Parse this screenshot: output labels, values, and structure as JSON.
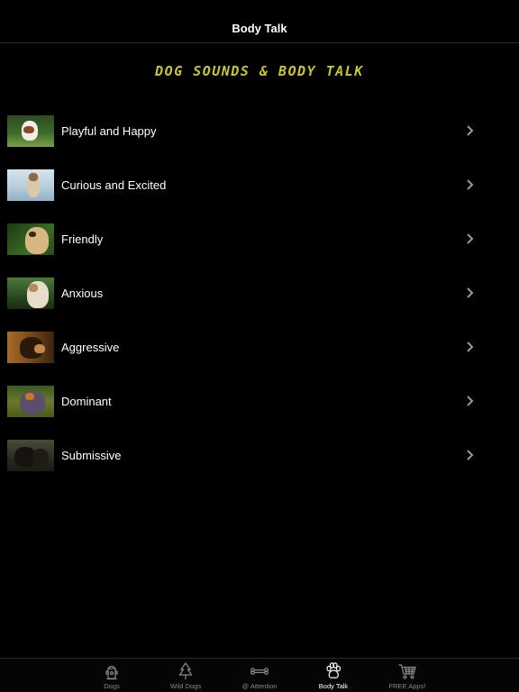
{
  "nav": {
    "title": "Body Talk"
  },
  "banner": {
    "text": "Dog Sounds & Body Talk"
  },
  "rows": [
    {
      "label": "Playful and Happy"
    },
    {
      "label": "Curious and Excited"
    },
    {
      "label": "Friendly"
    },
    {
      "label": "Anxious"
    },
    {
      "label": "Aggressive"
    },
    {
      "label": "Dominant"
    },
    {
      "label": "Submissive"
    }
  ],
  "tabs": [
    {
      "label": "Dogs",
      "icon": "fire-hydrant-icon"
    },
    {
      "label": "Wild Dogs",
      "icon": "tree-icon"
    },
    {
      "label": "@ Attention",
      "icon": "bone-icon"
    },
    {
      "label": "Body Talk",
      "icon": "paw-icon",
      "active": true
    },
    {
      "label": "FREE Apps!",
      "icon": "shopping-cart-icon"
    }
  ],
  "colors": {
    "accent": "#c8c62f",
    "background": "#000000",
    "tab_inactive": "#8a8a8a"
  }
}
